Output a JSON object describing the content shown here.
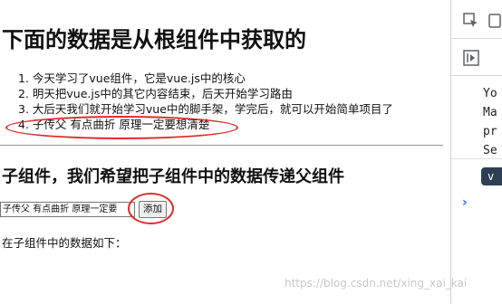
{
  "page": {
    "title": "下面的数据是从根组件中获取的",
    "todos": [
      "1. 今天学习了vue组件，它是vue.js中的核心",
      "2. 明天把vue.js中的其它内容结束，后天开始学习路由",
      "3. 大后天我们就开始学习vue中的脚手架，学完后，就可以开始简单项目了",
      "4. 子传父 有点曲折 原理一定要想清楚"
    ],
    "child_section": {
      "heading": "子组件，我们希望把子组件中的数据传递父组件",
      "input_value": "子传父 有点曲折 原理一定要",
      "add_button_label": "添加",
      "data_note": "在子组件中的数据如下："
    }
  },
  "devtools": {
    "console_lines": [
      "Yo",
      "Ma",
      "pr",
      "Se"
    ],
    "badge_text": "v",
    "prompt_symbol": "›"
  },
  "watermark": "https://blog.csdn.net/xing_xai_kai",
  "colors": {
    "annotation_red": "#e22b2b",
    "badge_bg": "#2e3f55",
    "prompt_blue": "#1a73e8"
  }
}
